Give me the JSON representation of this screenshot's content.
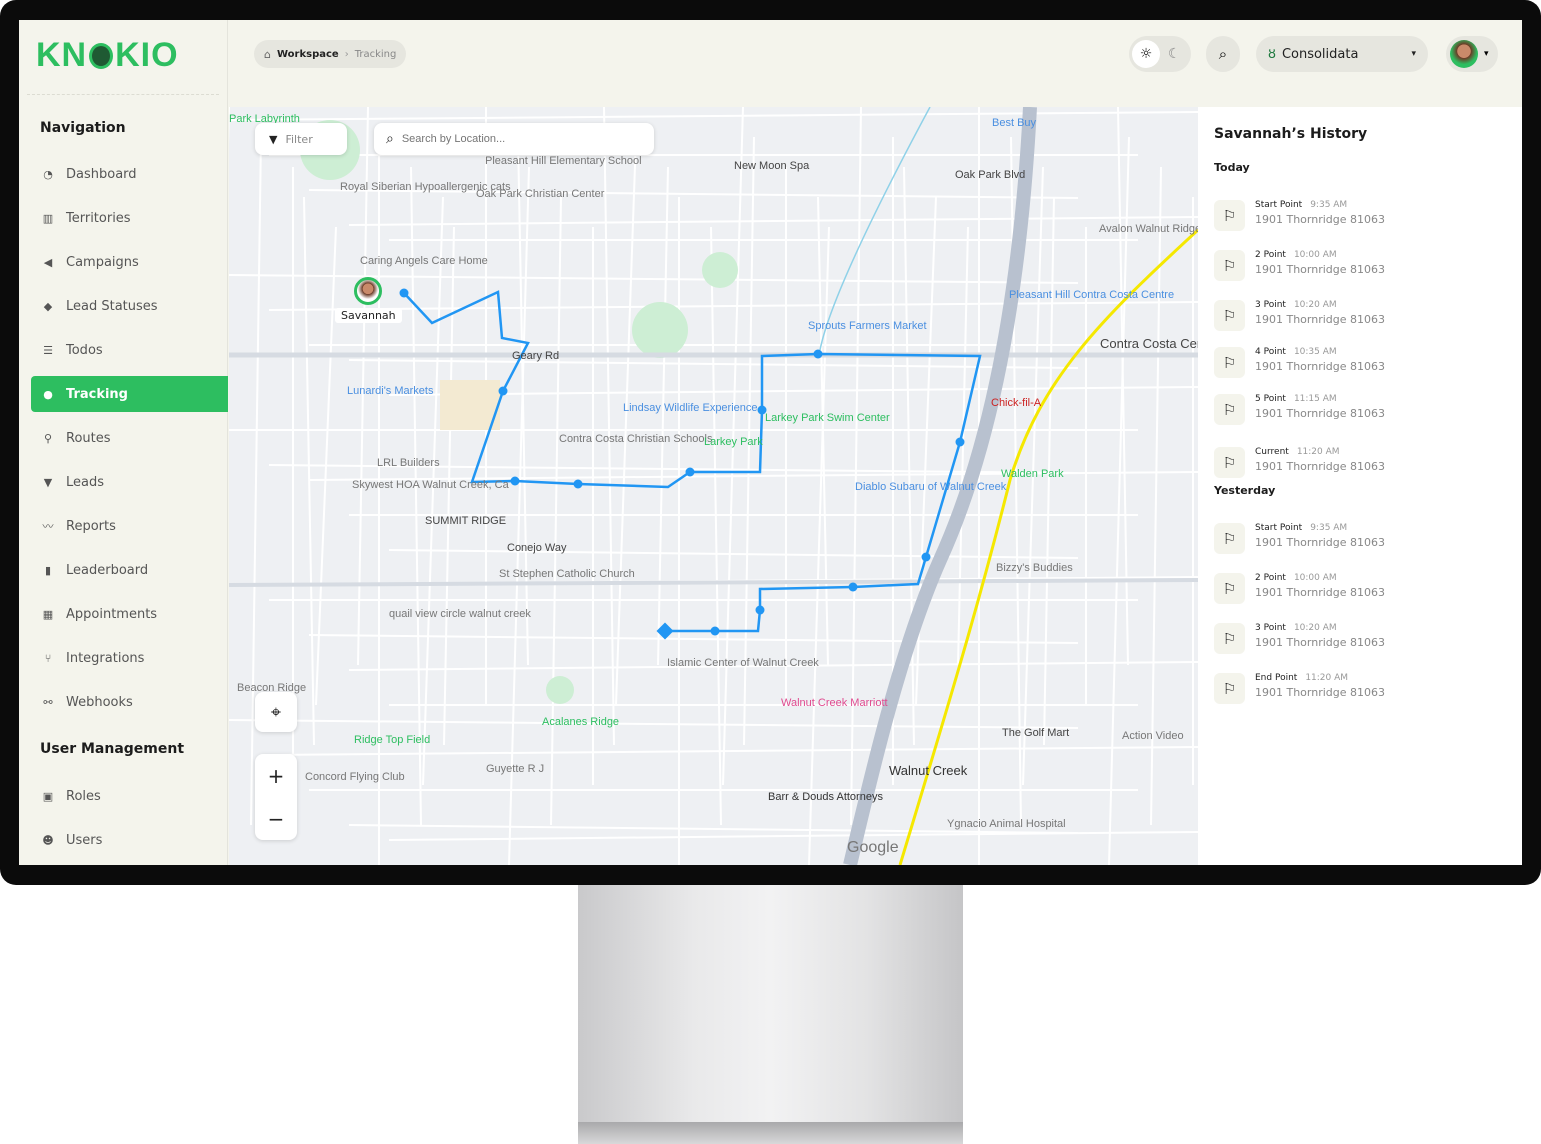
{
  "brand": {
    "logo_text": "KNOKIO",
    "accent": "#2dbe60"
  },
  "breadcrumb": {
    "root": "Workspace",
    "current": "Tracking"
  },
  "header": {
    "org": "Consolidata",
    "theme_light": "sun-icon",
    "theme_dark": "moon-icon"
  },
  "sidebar": {
    "nav_title": "Navigation",
    "items": [
      {
        "label": "Dashboard",
        "icon": "◔"
      },
      {
        "label": "Territories",
        "icon": "▥"
      },
      {
        "label": "Campaigns",
        "icon": "◀"
      },
      {
        "label": "Lead Statuses",
        "icon": "◆"
      },
      {
        "label": "Todos",
        "icon": "☰"
      },
      {
        "label": "Tracking",
        "icon": "●",
        "active": true
      },
      {
        "label": "Routes",
        "icon": "⚲"
      },
      {
        "label": "Leads",
        "icon": "▼"
      },
      {
        "label": "Reports",
        "icon": "〰"
      },
      {
        "label": "Leaderboard",
        "icon": "▮"
      },
      {
        "label": "Appointments",
        "icon": "▦"
      },
      {
        "label": "Integrations",
        "icon": "⑂"
      },
      {
        "label": "Webhooks",
        "icon": "⚯"
      }
    ],
    "user_title": "User Management",
    "user_items": [
      {
        "label": "Roles",
        "icon": "▣"
      },
      {
        "label": "Users",
        "icon": "☻"
      }
    ]
  },
  "map": {
    "filter_label": "Filter",
    "search_placeholder": "Search by Location...",
    "user_marker": "Savannah",
    "route_color": "#2196f3",
    "labels": [
      "Park Labyrinth",
      "Best Buy",
      "New Moon Spa",
      "Oak Park Blvd",
      "Pleasant Hill Elementary School",
      "Oak Park Christian Center",
      "Royal Siberian Hypoallergenic cats",
      "Caring Angels Care Home",
      "Avalon Walnut Ridge",
      "Sprouts Farmers Market",
      "Pleasant Hill Contra Costa Centre",
      "Contra Costa Centre",
      "Geary Rd",
      "Lunardi's Markets",
      "Lindsay Wildlife Experience",
      "Larkey Park Swim Center",
      "Chick-fil-A",
      "Contra Costa Christian Schools",
      "Larkey Park",
      "LRL Builders",
      "Walden Park",
      "Skywest HOA Walnut Creek, Ca",
      "Diablo Subaru of Walnut Creek",
      "SUMMIT RIDGE",
      "Conejo Way",
      "St Stephen Catholic Church",
      "Bizzy's Buddies",
      "quail view circle walnut creek",
      "Islamic Center of Walnut Creek",
      "Walnut Creek Marriott",
      "Beacon Ridge",
      "Acalanes Ridge",
      "The Golf Mart",
      "Action Video",
      "Ridge Top Field",
      "Concord Flying Club",
      "Guyette R J",
      "Walnut Creek",
      "Barr & Douds Attorneys",
      "Ygnacio Animal Hospital",
      "Google"
    ]
  },
  "history": {
    "title": "Savannah’s History",
    "groups": [
      {
        "label": "Today",
        "items": [
          {
            "name": "Start Point",
            "time": "9:35 AM",
            "address": "1901 Thornridge 81063"
          },
          {
            "name": "2 Point",
            "time": "10:00 AM",
            "address": "1901 Thornridge 81063"
          },
          {
            "name": "3 Point",
            "time": "10:20 AM",
            "address": "1901 Thornridge 81063"
          },
          {
            "name": "4 Point",
            "time": "10:35 AM",
            "address": "1901 Thornridge 81063"
          },
          {
            "name": "5 Point",
            "time": "11:15 AM",
            "address": "1901 Thornridge 81063"
          },
          {
            "name": "Current",
            "time": "11:20 AM",
            "address": "1901 Thornridge 81063"
          }
        ]
      },
      {
        "label": "Yesterday",
        "items": [
          {
            "name": "Start Point",
            "time": "9:35 AM",
            "address": "1901 Thornridge 81063"
          },
          {
            "name": "2 Point",
            "time": "10:00 AM",
            "address": "1901 Thornridge 81063"
          },
          {
            "name": "3 Point",
            "time": "10:20 AM",
            "address": "1901 Thornridge 81063"
          },
          {
            "name": "End Point",
            "time": "11:20 AM",
            "address": "1901 Thornridge 81063"
          }
        ]
      }
    ]
  }
}
